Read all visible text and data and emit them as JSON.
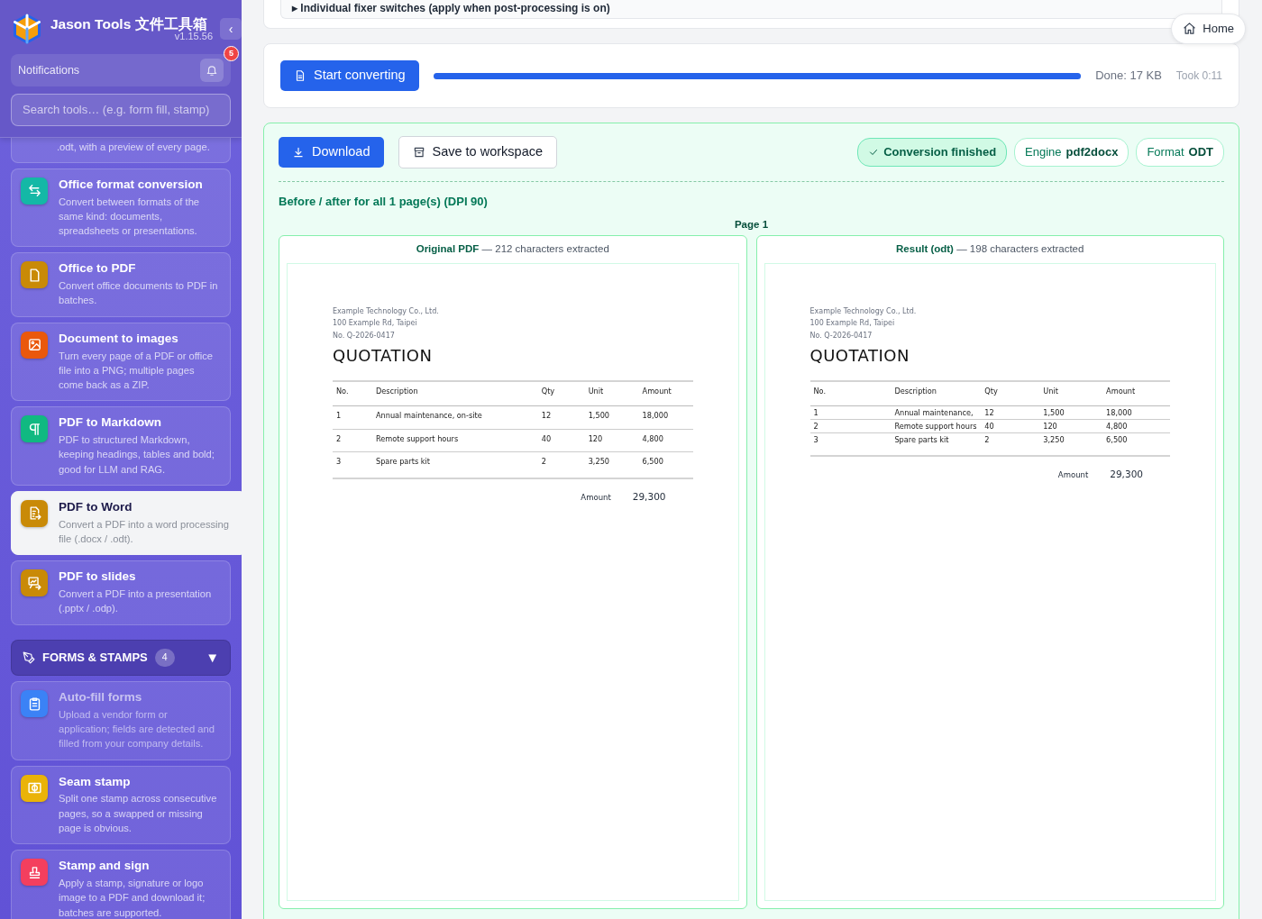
{
  "sidebar": {
    "app_title": "Jason Tools 文件工具箱",
    "version": "v1.15.56",
    "collapse_button": "‹",
    "notifications": {
      "label": "Notifications",
      "count": "5"
    },
    "search": {
      "placeholder": "Search tools… (e.g. form fill, stamp)"
    },
    "sections": [
      {
        "items": [
          {
            "description": ".odt, with a preview of every page.",
            "selected": false,
            "disabled": false
          },
          {
            "title": "Office format conversion",
            "description": "Convert between formats of the same kind: documents, spreadsheets or presentations.",
            "color": "#14b8a6",
            "selected": false,
            "disabled": false
          },
          {
            "title": "Office to PDF",
            "description": "Convert office documents to PDF in batches.",
            "color": "#c98a07",
            "selected": false,
            "disabled": false
          },
          {
            "title": "Document to images",
            "description": "Turn every page of a PDF or office file into a PNG; multiple pages come back as a ZIP.",
            "color": "#ea580c",
            "selected": false,
            "disabled": false
          },
          {
            "title": "PDF to Markdown",
            "description": "PDF to structured Markdown, keeping headings, tables and bold; good for LLM and RAG.",
            "color": "#10b981",
            "selected": false,
            "disabled": false
          },
          {
            "title": "PDF to Word",
            "description": "Convert a PDF into a word processing file (.docx / .odt).",
            "color": "#c98a07",
            "selected": true,
            "disabled": false
          },
          {
            "title": "PDF to slides",
            "description": "Convert a PDF into a presentation (.pptx / .odp).",
            "color": "#c98a07",
            "selected": false,
            "disabled": false
          }
        ]
      },
      {
        "title": "FORMS & STAMPS",
        "count": "4",
        "expanded": true,
        "toggle": "▼",
        "items": [
          {
            "title": "Auto-fill forms",
            "description": "Upload a vendor form or application; fields are detected and filled from your company details.",
            "color": "#3b82f6",
            "selected": false,
            "disabled": true
          },
          {
            "title": "Seam stamp",
            "description": "Split one stamp across consecutive pages, so a swapped or missing page is obvious.",
            "color": "#eab308",
            "selected": false,
            "disabled": false
          },
          {
            "title": "Stamp and sign",
            "description": "Apply a stamp, signature or logo image to a PDF and download it; batches are supported.",
            "color": "#f43f5e",
            "selected": false,
            "disabled": false
          }
        ]
      }
    ]
  },
  "home_button": "Home",
  "fixer_section": {
    "toggle": "▸",
    "label": "Individual fixer switches (apply when post-processing is on)"
  },
  "convert": {
    "button": "Start converting",
    "level": 1,
    "done": "Done: 17 KB",
    "took": "Took 0:11"
  },
  "result": {
    "download": "Download",
    "save": "Save to workspace",
    "status": "Conversion finished",
    "engine": {
      "label": "Engine",
      "value": "pdf2docx"
    },
    "format": {
      "label": "Format",
      "value": "ODT"
    },
    "compare_title": "Before / after for all 1 page(s) (DPI 90)",
    "page_label": "Page 1",
    "panels": [
      {
        "title": "Original PDF",
        "note": "— 212 characters extracted",
        "document": {
          "header_lines": [
            "Example Technology Co., Ltd.",
            "100 Example Rd, Taipei",
            "No. Q-2026-0417"
          ],
          "heading": "QUOTATION",
          "columns": [
            "No.",
            "Description",
            "Qty",
            "Unit",
            "Amount"
          ],
          "rows": [
            [
              "1",
              "Annual maintenance, on-site",
              "12",
              "1,500",
              "18,000"
            ],
            [
              "2",
              "Remote support hours",
              "40",
              "120",
              "4,800"
            ],
            [
              "3",
              "Spare parts kit",
              "2",
              "3,250",
              "6,500"
            ]
          ],
          "total_label": "Amount",
          "total_value": "29,300"
        }
      },
      {
        "title": "Result (odt)",
        "note": "— 198 characters extracted",
        "document": {
          "header_lines": [
            "Example Technology Co., Ltd.",
            "100 Example Rd, Taipei",
            "No. Q-2026-0417"
          ],
          "heading": "QUOTATION",
          "columns": [
            "No.",
            "Description",
            "Qty",
            "Unit",
            "Amount"
          ],
          "rows": [
            [
              "1",
              "Annual maintenance,",
              "12",
              "1,500",
              "18,000"
            ],
            [
              "2",
              "Remote support hours",
              "40",
              "120",
              "4,800"
            ],
            [
              "3",
              "Spare parts kit",
              "2",
              "3,250",
              "6,500"
            ]
          ],
          "total_label": "Amount",
          "total_value": "29,300"
        }
      }
    ]
  }
}
